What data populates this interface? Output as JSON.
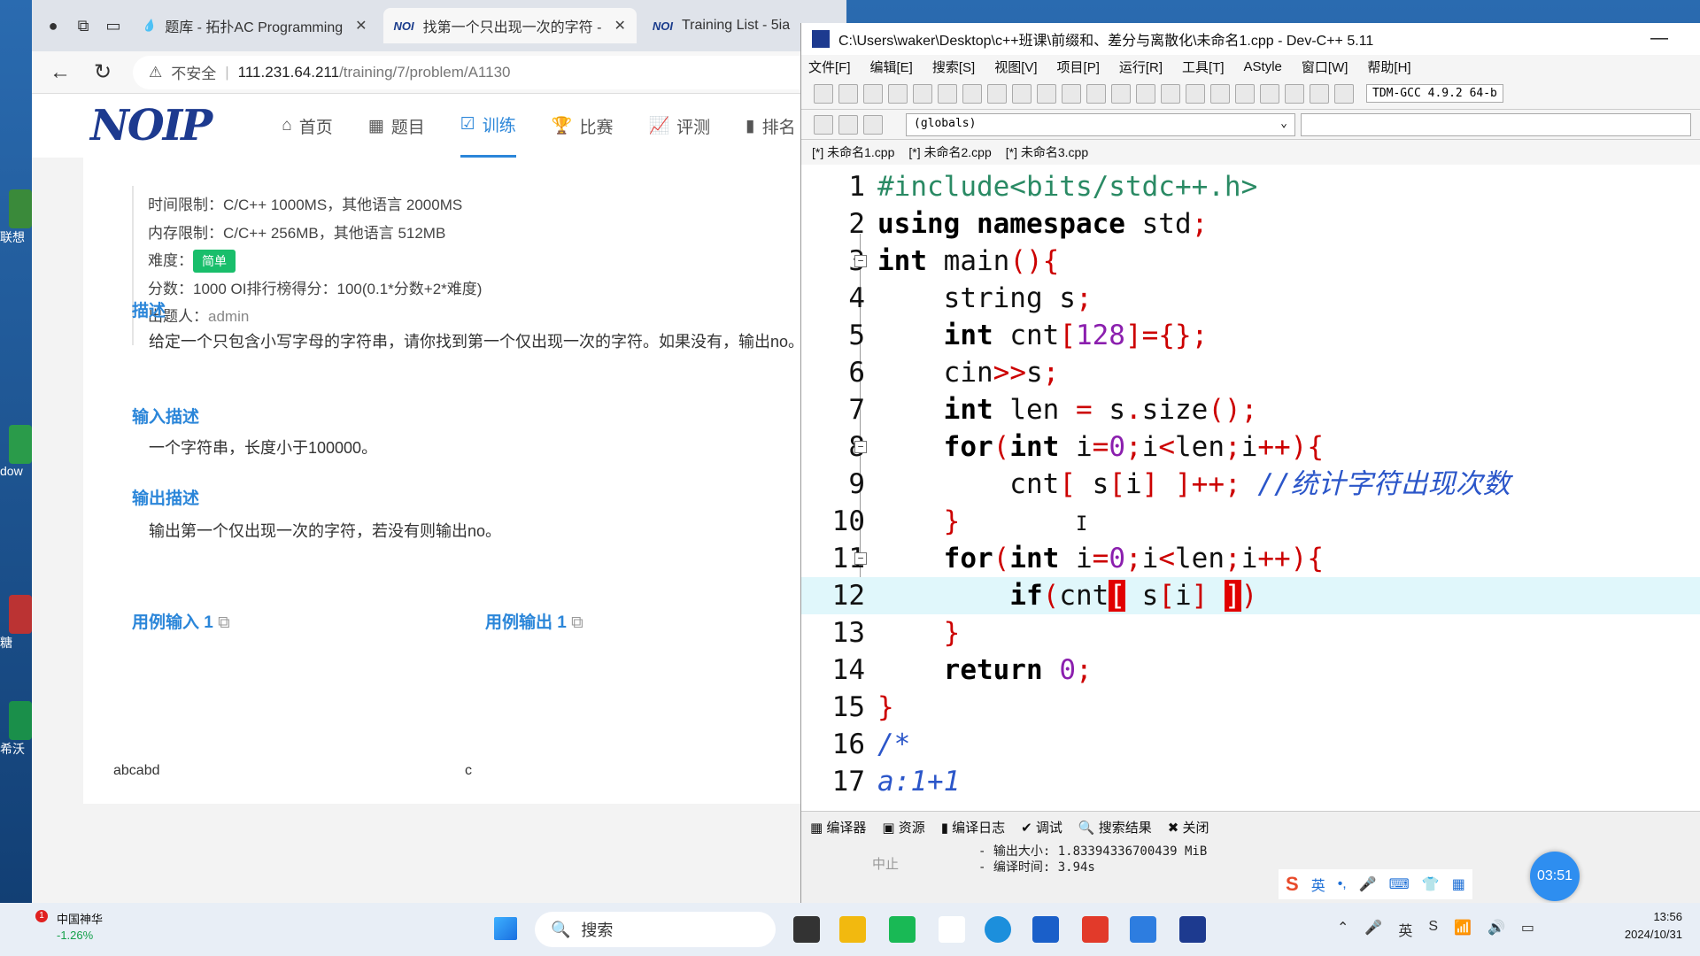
{
  "desktop": {
    "icons": [
      {
        "label": "联想"
      },
      {
        "label": "dow"
      },
      {
        "label": "糖"
      },
      {
        "label": "希沃"
      }
    ]
  },
  "browser": {
    "tabs": [
      {
        "title": "题库 - 拓扑AC Programming",
        "close": "✕"
      },
      {
        "title": "找第一个只出现一次的字符 - ",
        "close": "✕"
      },
      {
        "title": "Training List - 5ia",
        "close": ""
      }
    ],
    "address": {
      "insecure_label": "不安全",
      "host": "111.231.64.211",
      "path": "/training/7/problem/A1130"
    },
    "site": {
      "brand": "NOIP",
      "nav": [
        {
          "label": "首页",
          "icon": "home-icon"
        },
        {
          "label": "题目",
          "icon": "grid-icon"
        },
        {
          "label": "训练",
          "icon": "check-icon"
        },
        {
          "label": "比赛",
          "icon": "trophy-icon"
        },
        {
          "label": "评测",
          "icon": "chart-icon"
        },
        {
          "label": "排名",
          "icon": "bar-icon"
        }
      ]
    },
    "problem": {
      "time_limit": "时间限制：C/C++ 1000MS，其他语言 2000MS",
      "memory_limit": "内存限制：C/C++ 256MB，其他语言 512MB",
      "difficulty_label": "难度：",
      "difficulty": "简单",
      "score": "分数：1000   OI排行榜得分：100(0.1*分数+2*难度)",
      "author_label": "出题人：",
      "author": "admin",
      "desc_title": "描述",
      "desc": "给定一个只包含小写字母的字符串，请你找到第一个仅出现一次的字符。如果没有，输出no。",
      "input_title": "输入描述",
      "input": "一个字符串，长度小于100000。",
      "output_title": "输出描述",
      "output": "输出第一个仅出现一次的字符，若没有则输出no。",
      "sample_in_title": "用例输入 1",
      "sample_out_title": "用例输出 1",
      "sample_in": "abcabd",
      "sample_out": "c"
    }
  },
  "ide": {
    "title": "C:\\Users\\waker\\Desktop\\c++班课\\前缀和、差分与离散化\\未命名1.cpp - Dev-C++ 5.11",
    "menu": [
      "文件[F]",
      "编辑[E]",
      "搜索[S]",
      "视图[V]",
      "项目[P]",
      "运行[R]",
      "工具[T]",
      "AStyle",
      "窗口[W]",
      "帮助[H]"
    ],
    "compiler": "TDM-GCC 4.9.2 64-b",
    "scope": "(globals)",
    "file_tabs": [
      "[*] 未命名1.cpp",
      "[*] 未命名2.cpp",
      "[*] 未命名3.cpp"
    ],
    "line_numbers": [
      "1",
      "2",
      "3",
      "4",
      "5",
      "6",
      "7",
      "8",
      "9",
      "10",
      "11",
      "12",
      "13",
      "14",
      "15",
      "16",
      "17"
    ],
    "bottom_tabs": [
      "编译器",
      "资源",
      "编译日志",
      "调试",
      "搜索结果",
      "关闭"
    ],
    "stop_label": "中止",
    "log": [
      "- 输出大小: 1.83394336700439 MiB",
      "- 编译时间: 3.94s"
    ]
  },
  "overlay": {
    "timer": "03:51",
    "ime": [
      "英",
      "•,",
      "🎤",
      "⌨",
      "👕",
      "▦"
    ]
  },
  "taskbar": {
    "stock_name": "中国神华",
    "stock_change": "-1.26%",
    "notify_count": "1",
    "search": "搜索",
    "time": "13:56",
    "date": "2024/10/31"
  }
}
